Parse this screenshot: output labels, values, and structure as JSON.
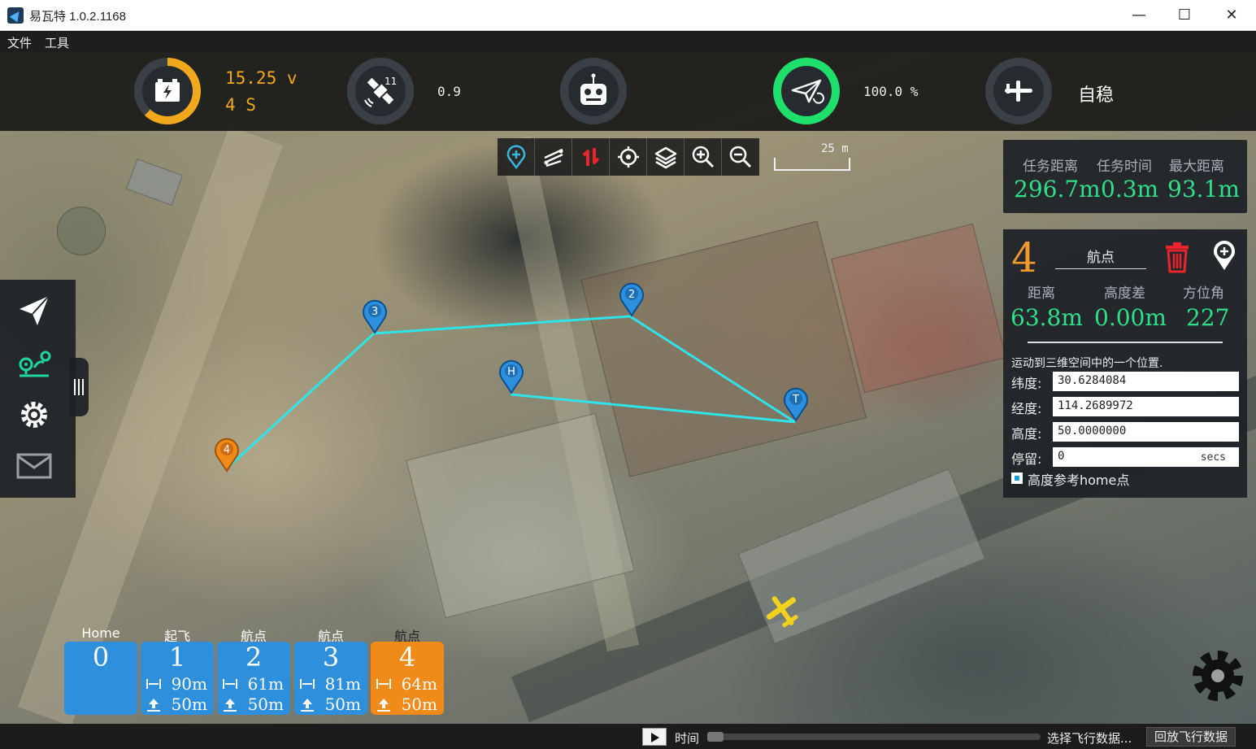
{
  "window": {
    "title": "易瓦特 1.0.2.1168",
    "minimize": "—",
    "maximize": "☐",
    "close": "✕"
  },
  "menu": {
    "items": [
      "文件",
      "工具"
    ]
  },
  "status": {
    "battery_voltage": "15.25 v",
    "battery_cells": "4 S",
    "battery_level_fraction": 0.62,
    "satellite_count": "11",
    "hdop": "0.9",
    "mission_progress": "100.0 %",
    "mission_progress_fraction": 1.0,
    "flight_mode": "自稳"
  },
  "colors": {
    "battery": "#f2a81d",
    "progress": "#1fe06a",
    "accent_green": "#2fe08a",
    "wp_blue": "#2e8fdc",
    "wp_orange": "#f08a18",
    "route": "#2fe3e8",
    "plane": "#f2d21c"
  },
  "map_tools": [
    "add-waypoint-icon",
    "route-icon",
    "swap-icon",
    "locate-icon",
    "layers-icon",
    "zoom-in-icon",
    "zoom-out-icon"
  ],
  "scale": {
    "label": "25 m"
  },
  "mission_stats": {
    "labels": [
      "任务距离",
      "任务时间",
      "最大距离"
    ],
    "values": [
      "296.7m",
      "0.3m",
      "93.1m"
    ]
  },
  "waypoint": {
    "number": "4",
    "type": "航点",
    "labels": [
      "距离",
      "高度差",
      "方位角"
    ],
    "values": [
      "63.8m",
      "0.00m",
      "227"
    ],
    "description": "运动到三维空间中的一个位置.",
    "fields": [
      {
        "label": "纬度:",
        "value": "30.6284084",
        "unit": ""
      },
      {
        "label": "经度:",
        "value": "114.2689972",
        "unit": ""
      },
      {
        "label": "高度:",
        "value": "50.0000000",
        "unit": ""
      },
      {
        "label": "停留:",
        "value": "0",
        "unit": "secs"
      }
    ],
    "checkbox_label": "高度参考home点",
    "checkbox_checked": true
  },
  "map_markers": [
    {
      "label": "3",
      "color": "blue"
    },
    {
      "label": "2",
      "color": "blue"
    },
    {
      "label": "H",
      "color": "blue"
    },
    {
      "label": "T",
      "color": "blue"
    },
    {
      "label": "4",
      "color": "orange"
    }
  ],
  "waypoint_cards": [
    {
      "caption": "Home",
      "number": "0",
      "distance": "",
      "altitude": "",
      "color": "blue"
    },
    {
      "caption": "起飞",
      "number": "1",
      "distance": "90m",
      "altitude": "50m",
      "color": "blue"
    },
    {
      "caption": "航点",
      "number": "2",
      "distance": "61m",
      "altitude": "50m",
      "color": "blue"
    },
    {
      "caption": "航点",
      "number": "3",
      "distance": "81m",
      "altitude": "50m",
      "color": "blue"
    },
    {
      "caption": "航点",
      "number": "4",
      "distance": "64m",
      "altitude": "50m",
      "color": "orange"
    }
  ],
  "bottom": {
    "time_label": "时间",
    "select_label": "选择飞行数据...",
    "replay_label": "回放飞行数据"
  }
}
